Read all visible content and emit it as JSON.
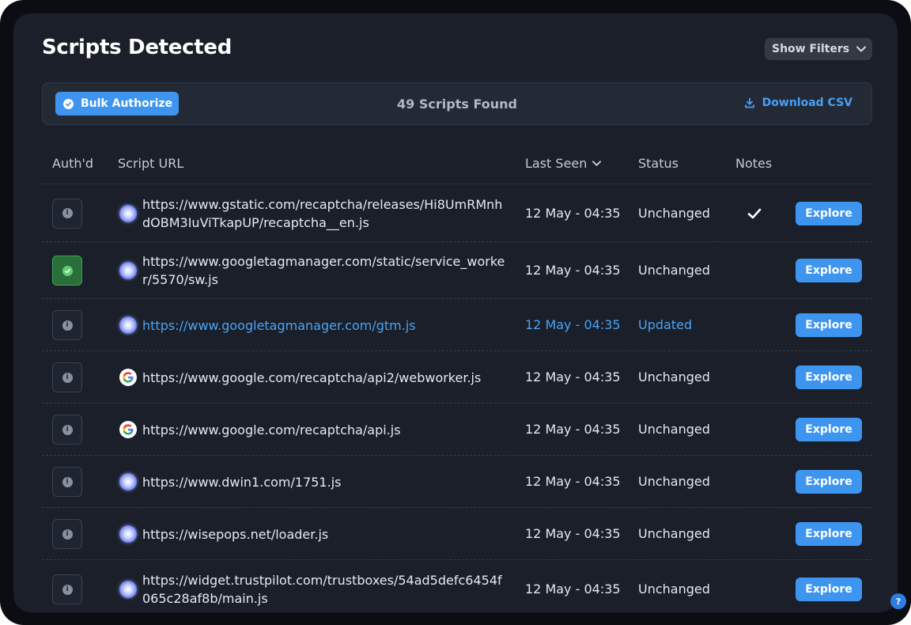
{
  "header": {
    "title": "Scripts Detected",
    "filters_label": "Show Filters"
  },
  "toolbar": {
    "bulk_label": "Bulk Authorize",
    "count_text": "49 Scripts Found",
    "csv_label": "Download CSV"
  },
  "table": {
    "columns": {
      "auth": "Auth'd",
      "url": "Script URL",
      "last_seen": "Last Seen",
      "status": "Status",
      "notes": "Notes"
    },
    "explore_label": "Explore",
    "rows": [
      {
        "url": "https://www.gstatic.com/recaptcha/releases/Hi8UmRMnhdOBM3IuViTkapUP/recaptcha__en.js",
        "last_seen": "12 May - 04:35",
        "status": "Unchanged",
        "authorized": false,
        "favicon": "globe-icon",
        "note": "check-icon",
        "highlight": false
      },
      {
        "url": "https://www.googletagmanager.com/static/service_worker/5570/sw.js",
        "last_seen": "12 May - 04:35",
        "status": "Unchanged",
        "authorized": true,
        "favicon": "globe-icon",
        "note": "",
        "highlight": false
      },
      {
        "url": "https://www.googletagmanager.com/gtm.js",
        "last_seen": "12 May - 04:35",
        "status": "Updated",
        "authorized": false,
        "favicon": "globe-icon",
        "note": "",
        "highlight": true
      },
      {
        "url": "https://www.google.com/recaptcha/api2/webworker.js",
        "last_seen": "12 May - 04:35",
        "status": "Unchanged",
        "authorized": false,
        "favicon": "google-icon",
        "note": "",
        "highlight": false
      },
      {
        "url": "https://www.google.com/recaptcha/api.js",
        "last_seen": "12 May - 04:35",
        "status": "Unchanged",
        "authorized": false,
        "favicon": "google-icon",
        "note": "",
        "highlight": false
      },
      {
        "url": "https://www.dwin1.com/1751.js",
        "last_seen": "12 May - 04:35",
        "status": "Unchanged",
        "authorized": false,
        "favicon": "globe-icon",
        "note": "",
        "highlight": false
      },
      {
        "url": "https://wisepops.net/loader.js",
        "last_seen": "12 May - 04:35",
        "status": "Unchanged",
        "authorized": false,
        "favicon": "globe-icon",
        "note": "",
        "highlight": false
      },
      {
        "url": "https://widget.trustpilot.com/trustboxes/54ad5defc6454f065c28af8b/main.js",
        "last_seen": "12 May - 04:35",
        "status": "Unchanged",
        "authorized": false,
        "favicon": "globe-icon",
        "note": "",
        "highlight": false
      }
    ]
  },
  "colors": {
    "accent": "#3d95f0",
    "link": "#4aa3f5",
    "authorized_bg": "#2a6f3a",
    "panel_bg": "#1a1f29"
  }
}
